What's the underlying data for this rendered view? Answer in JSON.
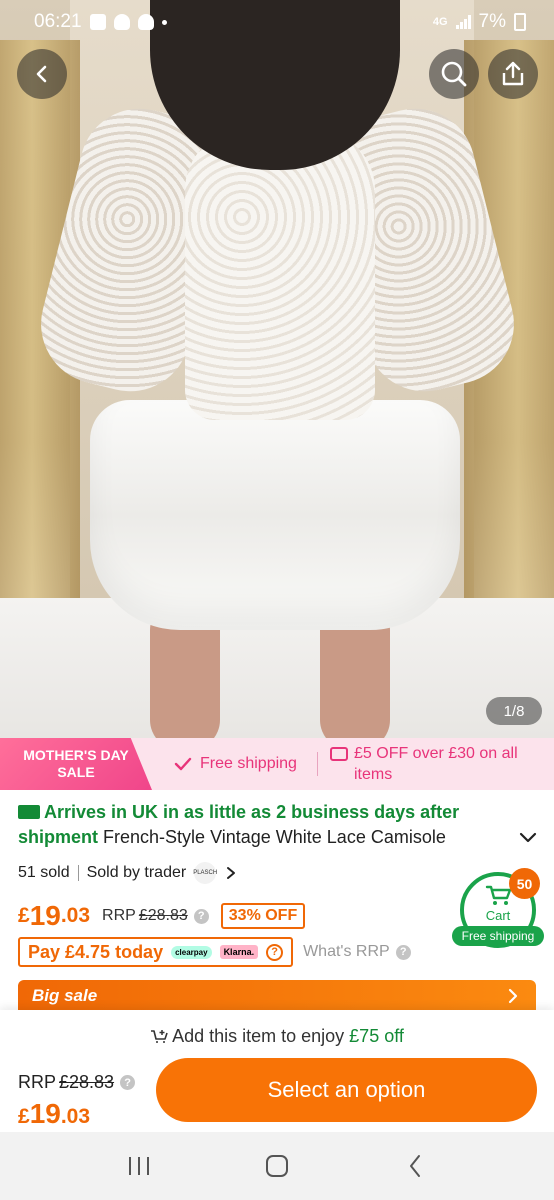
{
  "status_bar": {
    "time": "06:21",
    "network": "4G",
    "battery": "7%"
  },
  "hero": {
    "image_counter": "1/8"
  },
  "promo": {
    "badge_line1": "MOTHER'S DAY",
    "badge_line2": "SALE",
    "free_shipping": "Free shipping",
    "coupon_text": "£5 OFF over £30 on all items"
  },
  "product": {
    "delivery_text": "Arrives in UK in as little as  2 business days after shipment",
    "title": "French-Style Vintage White Lace Camisole",
    "sold": "51 sold",
    "seller": "Sold by trader",
    "seller_logo_text": "PLASCH"
  },
  "price": {
    "currency": "£",
    "integer": "19",
    "decimal": ".03",
    "rrp_label": "RRP",
    "rrp_value": "£28.83",
    "discount": "33% OFF"
  },
  "payment": {
    "pay_today": "Pay £4.75 today",
    "clearpay": "clearpay",
    "klarna": "Klarna.",
    "whats_rrp": "What's RRP"
  },
  "cart": {
    "count": "50",
    "label": "Cart",
    "free_shipping": "Free shipping"
  },
  "big_sale": {
    "label": "Big sale"
  },
  "bottom": {
    "add_text": "Add this item to enjoy ",
    "add_amount": "£75 off",
    "rrp_label": "RRP",
    "rrp_value": "£28.83",
    "price_currency": "£",
    "price_integer": "19",
    "price_decimal": ".03",
    "cta": "Select an option"
  },
  "colors": {
    "accent_orange": "#f06806",
    "pink": "#e8347a",
    "green": "#138a36"
  }
}
